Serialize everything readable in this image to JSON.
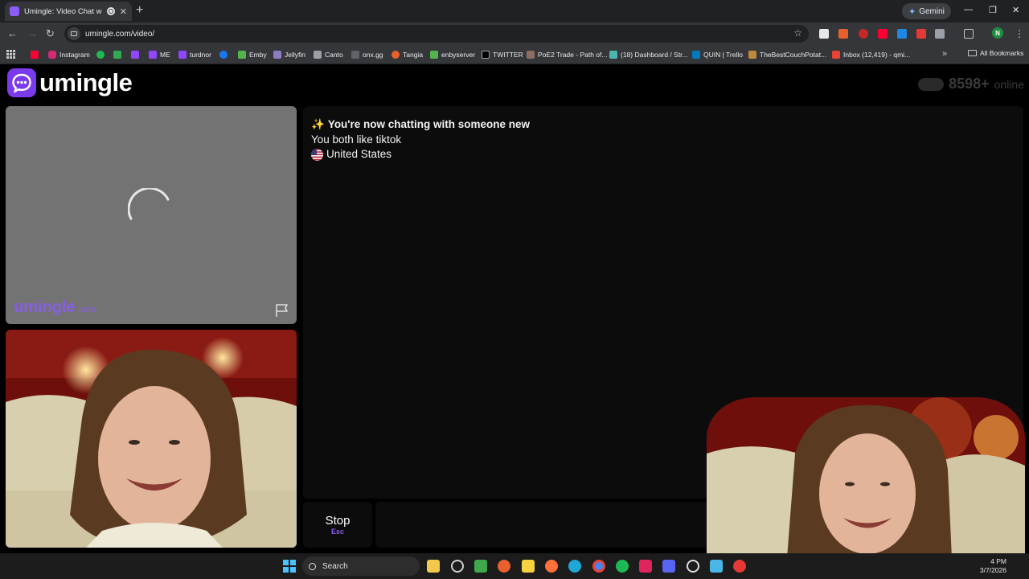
{
  "browser": {
    "tab_title": "Umingle: Video Chat with S",
    "new_tab": "+",
    "gemini_label": "Gemini",
    "url": "umingle.com/video/",
    "bookmarks": [
      "Instagram",
      "ME",
      "turdnor",
      "Emby",
      "Jellyfin",
      "Canto",
      "onx.gg",
      "Tangia",
      "enbyserver",
      "TWITTER",
      "PoE2 Trade - Path of...",
      "(18) Dashboard / Str...",
      "QUIN | Trello",
      "TheBestCouchPotat...",
      "Inbox (12,419) - qmi..."
    ],
    "all_bookmarks": "All Bookmarks",
    "profile_initial": "N"
  },
  "site": {
    "logo_text": "umingle",
    "online_count": "8598+",
    "online_label": "online",
    "watermark_name": "umingle",
    "watermark_domain": ".com"
  },
  "chat": {
    "headline_emoji": "✨",
    "headline": "You're now chatting with someone new",
    "interests": "You both like tiktok",
    "country": "United States"
  },
  "controls": {
    "stop_label": "Stop",
    "stop_key": "Esc",
    "message_placeholder": ""
  },
  "taskbar": {
    "search_label": "Search",
    "time": "4 PM",
    "date": "3/7/2026"
  },
  "colors": {
    "brand": "#7c3aed",
    "brand_light": "#8b5cf6",
    "panel": "#0c0c0c"
  }
}
